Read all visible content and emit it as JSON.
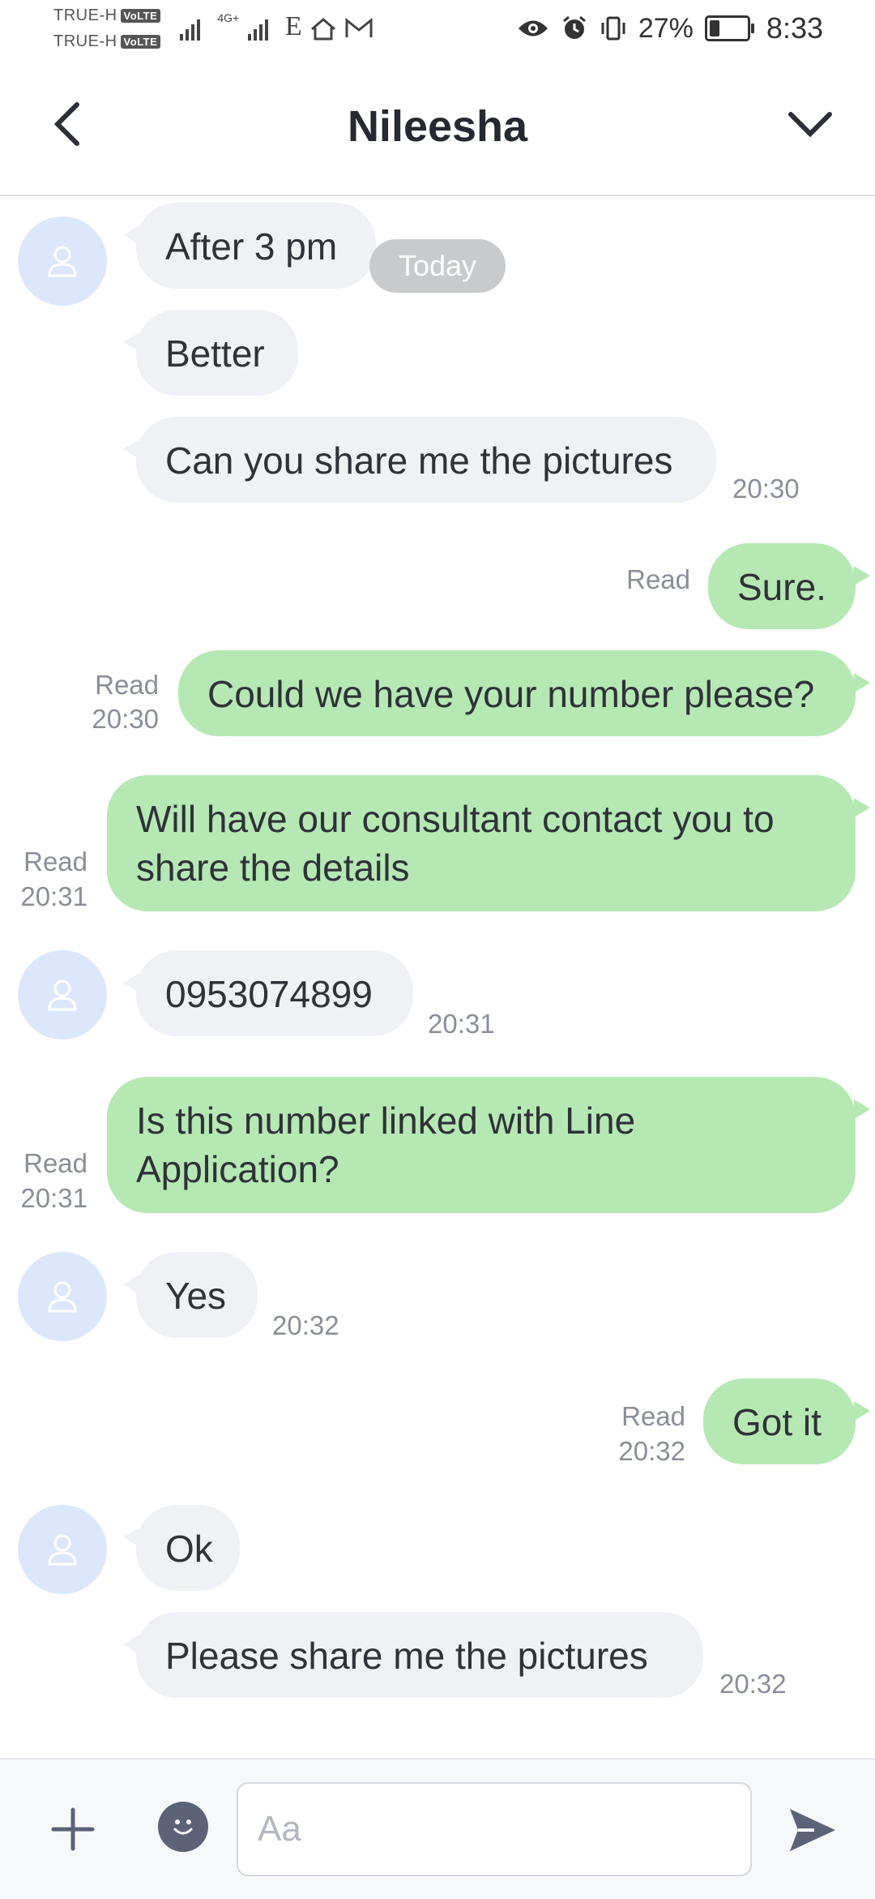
{
  "status_bar": {
    "carrier_1": "TRUE-H",
    "carrier_2": "TRUE-H",
    "volte": "VoLTE",
    "network": "4G+",
    "edge": "E",
    "battery_percent": "27%",
    "battery_level": 0.27,
    "time": "8:33"
  },
  "header": {
    "contact_name": "Nileesha"
  },
  "date_separator": "Today",
  "messages": [
    {
      "dir": "in",
      "text": "After 3 pm",
      "time": "",
      "read": ""
    },
    {
      "dir": "in",
      "text": "Better",
      "time": "",
      "read": ""
    },
    {
      "dir": "in",
      "text": "Can you share me the pictures",
      "time": "20:30",
      "read": ""
    },
    {
      "dir": "out",
      "text": "Sure.",
      "time": "",
      "read": "Read"
    },
    {
      "dir": "out",
      "text": "Could we have your number please?",
      "time": "20:30",
      "read": "Read"
    },
    {
      "dir": "out",
      "text": "Will have our consultant contact you to share the details",
      "time": "20:31",
      "read": "Read"
    },
    {
      "dir": "in",
      "text": "0953074899",
      "time": "20:31",
      "read": ""
    },
    {
      "dir": "out",
      "text": "Is this number linked with Line Application?",
      "time": "20:31",
      "read": "Read"
    },
    {
      "dir": "in",
      "text": "Yes",
      "time": "20:32",
      "read": ""
    },
    {
      "dir": "out",
      "text": "Got it",
      "time": "20:32",
      "read": "Read"
    },
    {
      "dir": "in",
      "text": "Ok",
      "time": "",
      "read": ""
    },
    {
      "dir": "in",
      "text": "Please share me the pictures",
      "time": "20:32",
      "read": ""
    }
  ],
  "input": {
    "placeholder": "Aa"
  },
  "icons": {
    "back": "chevron-left-icon",
    "menu": "chevron-down-icon",
    "plus": "plus-icon",
    "emoji": "smiley-icon",
    "send": "send-icon",
    "avatar": "person-icon"
  },
  "colors": {
    "incoming_bubble": "#f0f1f4",
    "outgoing_bubble": "#b6e8b3",
    "avatar_bg": "#dde7fb"
  }
}
